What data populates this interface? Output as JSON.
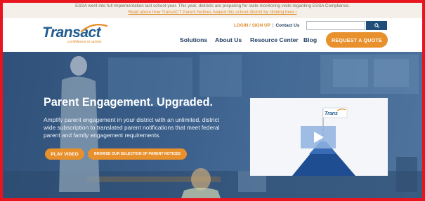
{
  "announcement": {
    "line1": "ESSA went into full implementation last school-year. This year, districts are preparing for state monitoring visits regarding ESSA Compliance.",
    "line2": "Read about how TransACT Parent Notices helped this school district by clicking here ›"
  },
  "logo": {
    "brand_trans": "Trans",
    "brand_act": "act",
    "tagline": "confidence in action"
  },
  "utility": {
    "login": "LOGIN / SIGN UP",
    "separator": "|",
    "contact": "Contact Us"
  },
  "search": {
    "placeholder": "",
    "button_icon": "search-icon"
  },
  "nav": {
    "items": [
      "Solutions",
      "About Us",
      "Resource Center",
      "Blog"
    ],
    "cta": "REQUEST A QUOTE"
  },
  "hero": {
    "title": "Parent Engagement. Upgraded.",
    "description": "Amplify parent engagement in your district with an unlimited, district wide subscription to translated parent notifications that meet federal parent and family engagement requirements.",
    "play_button": "PLAY VIDEO",
    "browse_button": "BROWSE OUR SELECTION OF PARENT NOTICES"
  },
  "video": {
    "flag_label": "Trans",
    "play_icon": "play-icon"
  },
  "colors": {
    "accent_orange": "#e8902c",
    "navy": "#1e3a5f",
    "frame_red": "#e8141e"
  }
}
